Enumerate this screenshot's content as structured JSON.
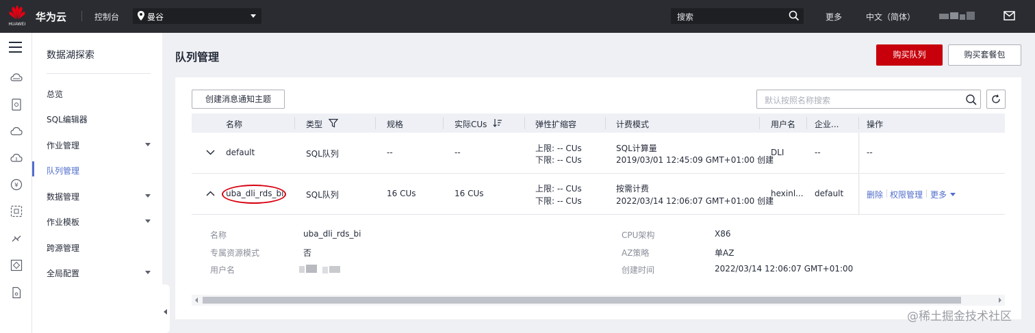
{
  "topbar": {
    "logo_text": "HUAWEI",
    "brand": "华为云",
    "console": "控制台",
    "region": "曼谷",
    "search_placeholder": "搜索",
    "more": "更多",
    "language": "中文（简体）"
  },
  "subnav": {
    "title": "数据湖探索",
    "items": [
      {
        "label": "总览"
      },
      {
        "label": "SQL编辑器"
      },
      {
        "label": "作业管理"
      },
      {
        "label": "队列管理"
      },
      {
        "label": "数据管理"
      },
      {
        "label": "作业模板"
      },
      {
        "label": "跨源管理"
      },
      {
        "label": "全局配置"
      }
    ]
  },
  "page": {
    "title": "队列管理",
    "buy_queue": "购买队列",
    "buy_package": "购买套餐包",
    "create_topic": "创建消息通知主题",
    "search_placeholder": "默认按照名称搜索"
  },
  "table": {
    "headers": [
      "名称",
      "类型",
      "规格",
      "实际CUs",
      "弹性扩缩容",
      "计费模式",
      "用户名",
      "企业...",
      "操作"
    ],
    "rows": [
      {
        "name": "default",
        "type": "SQL队列",
        "spec": "--",
        "actual_cus": "--",
        "scale_upper": "上限: -- CUs",
        "scale_lower": "下限: -- CUs",
        "billing_mode": "SQL计算量",
        "billing_time": "2019/03/01 12:45:09 GMT+01:00 创建",
        "user": "DLI",
        "enterprise": "--",
        "ops": "--"
      },
      {
        "name": "uba_dli_rds_bi",
        "type": "SQL队列",
        "spec": "16 CUs",
        "actual_cus": "16 CUs",
        "scale_upper": "上限: -- CUs",
        "scale_lower": "下限: -- CUs",
        "billing_mode": "按需计费",
        "billing_time": "2022/03/14 12:06:07 GMT+01:00 创建",
        "user": "hexinl...",
        "enterprise": "default",
        "op_delete": "删除",
        "op_permission": "权限管理",
        "op_more": "更多"
      }
    ]
  },
  "detail": {
    "name_label": "名称",
    "name_value": "uba_dli_rds_bi",
    "dedicated_label": "专属资源模式",
    "dedicated_value": "否",
    "user_label": "用户名",
    "cpu_label": "CPU架构",
    "cpu_value": "X86",
    "az_label": "AZ策略",
    "az_value": "单AZ",
    "created_label": "创建时间",
    "created_value": "2022/03/14 12:06:07 GMT+01:00"
  },
  "watermark": "@稀土掘金技术社区",
  "colors": {
    "topbar": "#2b2c31",
    "primary_red": "#c7000b",
    "link_blue": "#526ecc",
    "annotation_red": "#d7000f"
  }
}
